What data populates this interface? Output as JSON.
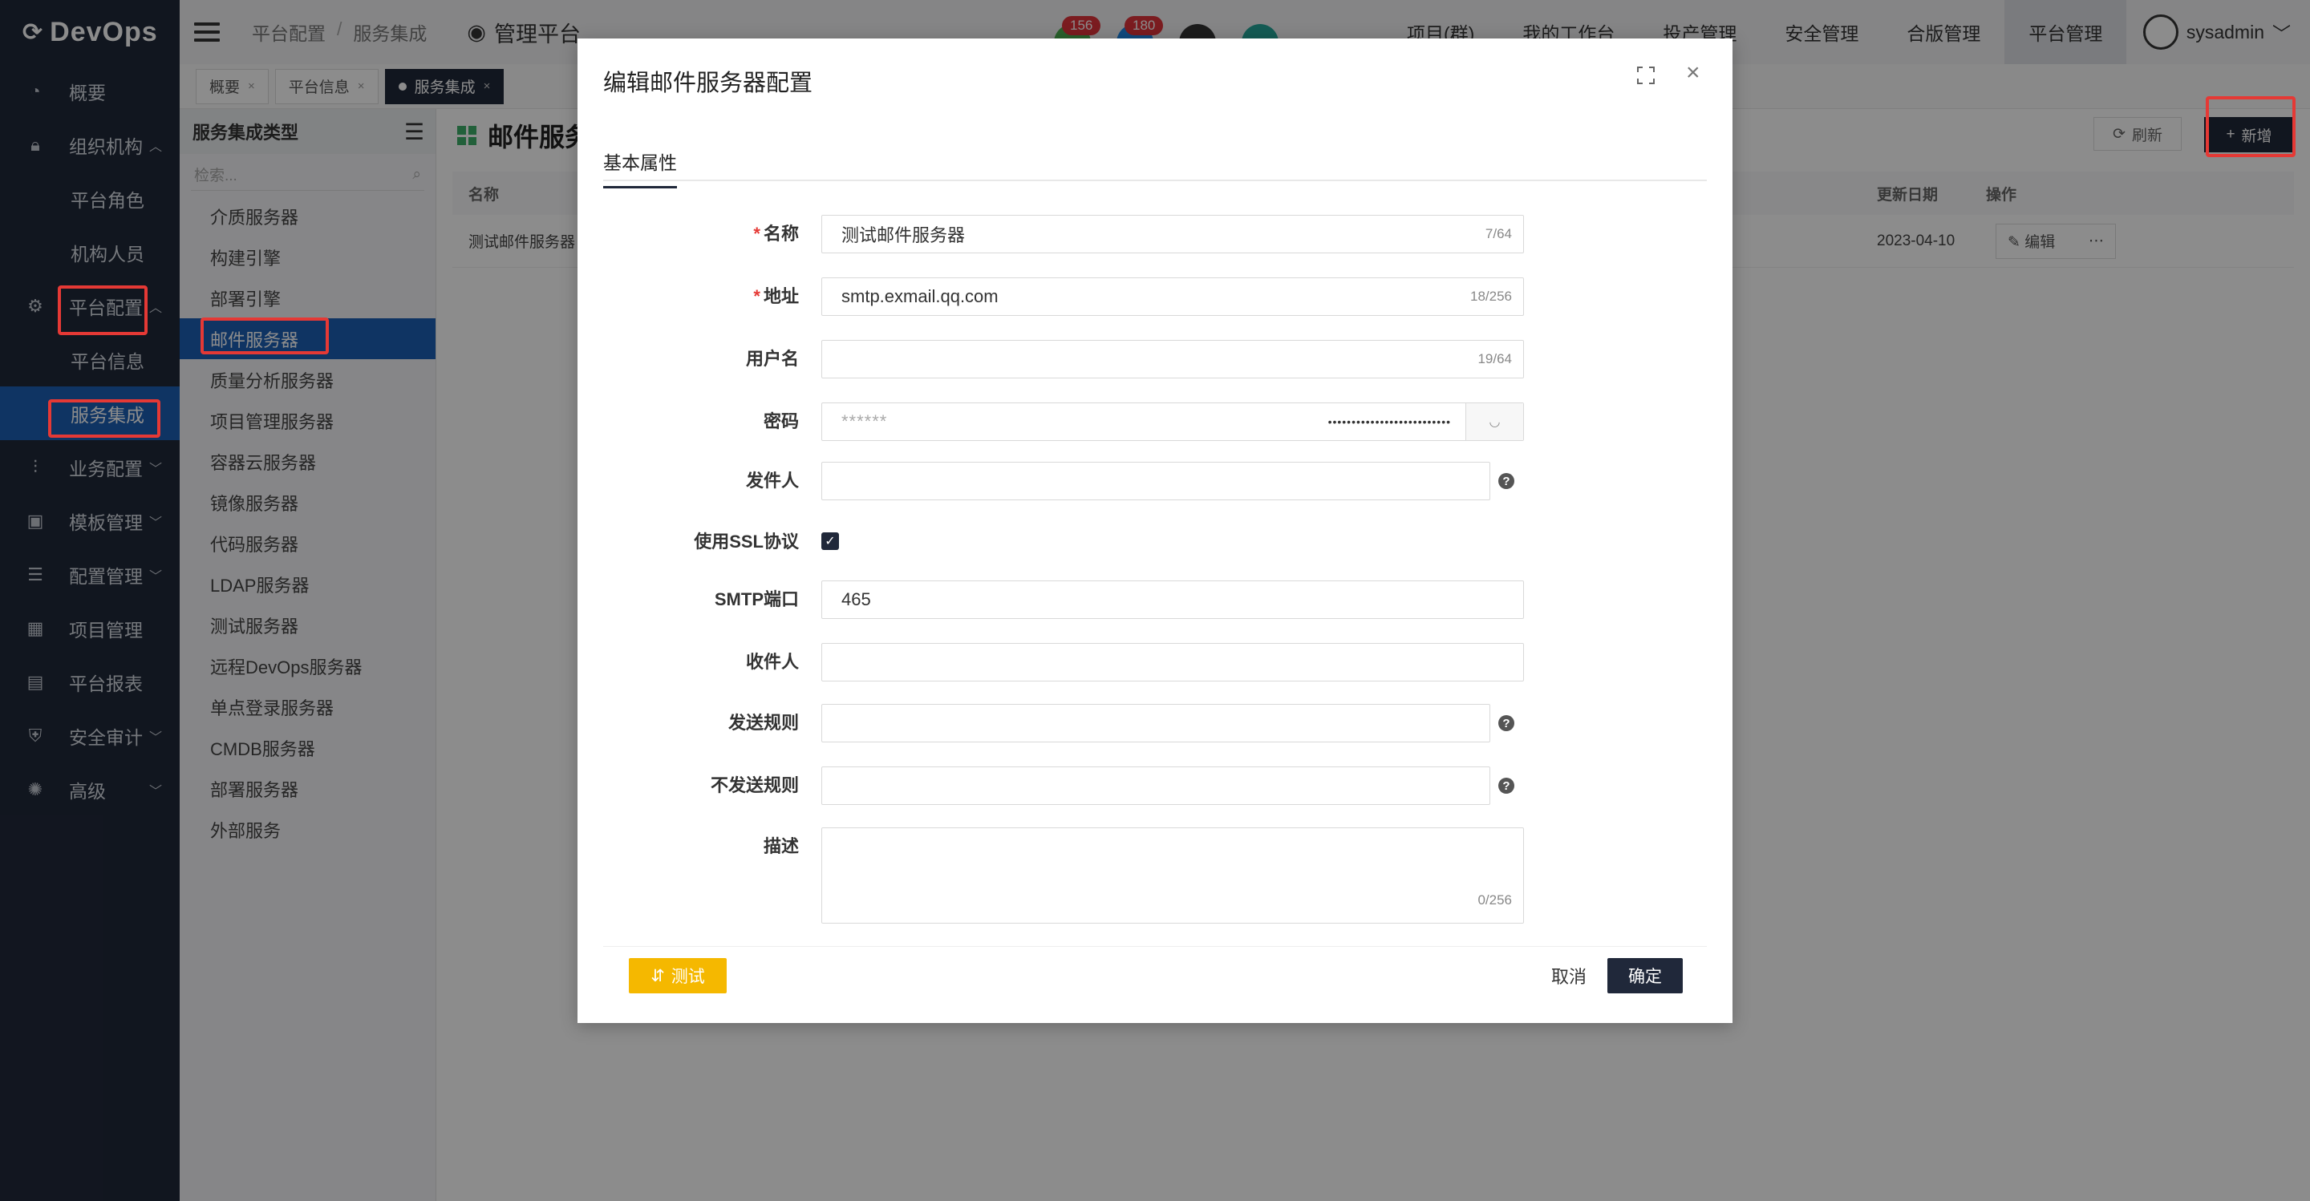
{
  "app": {
    "logo": "DevOps"
  },
  "sidebar": {
    "items": [
      {
        "label": "概要",
        "icon": "dashboard-icon"
      },
      {
        "label": "组织机构",
        "icon": "lock-icon"
      },
      {
        "label": "平台角色"
      },
      {
        "label": "机构人员"
      },
      {
        "label": "平台配置",
        "icon": "gear-icon"
      },
      {
        "label": "平台信息"
      },
      {
        "label": "服务集成"
      },
      {
        "label": "业务配置",
        "icon": "sliders-icon"
      },
      {
        "label": "模板管理",
        "icon": "template-icon"
      },
      {
        "label": "配置管理",
        "icon": "database-icon"
      },
      {
        "label": "项目管理",
        "icon": "grid-icon"
      },
      {
        "label": "平台报表",
        "icon": "report-icon"
      },
      {
        "label": "安全审计",
        "icon": "shield-icon"
      },
      {
        "label": "高级",
        "icon": "advanced-icon"
      }
    ]
  },
  "topbar": {
    "breadcrumb": [
      "平台配置",
      "服务集成"
    ],
    "platform_label": "管理平台",
    "badges": [
      {
        "count": "156",
        "color": "#4caf50",
        "icon": "doc-icon"
      },
      {
        "count": "180",
        "color": "#1e88e5",
        "icon": "bell-icon"
      },
      {
        "count": "",
        "color": "#333333",
        "icon": "help-icon"
      },
      {
        "count": "",
        "color": "#26a69a",
        "icon": "link-icon"
      }
    ],
    "nav": [
      "项目(群)",
      "我的工作台",
      "投产管理",
      "安全管理",
      "合版管理",
      "平台管理"
    ],
    "user": "sysadmin"
  },
  "page_tabs": [
    "概要",
    "平台信息",
    "服务集成"
  ],
  "type_panel": {
    "title": "服务集成类型",
    "search_placeholder": "检索...",
    "items": [
      "介质服务器",
      "构建引擎",
      "部署引擎",
      "邮件服务器",
      "质量分析服务器",
      "项目管理服务器",
      "容器云服务器",
      "镜像服务器",
      "代码服务器",
      "LDAP服务器",
      "测试服务器",
      "远程DevOps服务器",
      "单点登录服务器",
      "CMDB服务器",
      "部署服务器",
      "外部服务"
    ]
  },
  "main": {
    "title": "邮件服务",
    "refresh_label": "刷新",
    "add_label": "新增",
    "columns": {
      "name": "名称",
      "date": "更新日期",
      "op": "操作"
    },
    "rows": [
      {
        "name": "测试邮件服务器",
        "date": "2023-04-10",
        "edit": "编辑"
      }
    ]
  },
  "modal": {
    "title": "编辑邮件服务器配置",
    "tab": "基本属性",
    "fields": {
      "name": {
        "label": "名称",
        "value": "测试邮件服务器",
        "count": "7/64"
      },
      "address": {
        "label": "地址",
        "value": "smtp.exmail.qq.com",
        "count": "18/256"
      },
      "username": {
        "label": "用户名",
        "value": "",
        "count": "19/64"
      },
      "password": {
        "label": "密码",
        "placeholder": "******",
        "dots": "••••••••••••••••••••••••••"
      },
      "sender": {
        "label": "发件人",
        "value": ""
      },
      "ssl": {
        "label": "使用SSL协议",
        "checked": true
      },
      "port": {
        "label": "SMTP端口",
        "value": "465"
      },
      "recipient": {
        "label": "收件人",
        "value": ""
      },
      "send_rule": {
        "label": "发送规则",
        "value": ""
      },
      "no_send_rule": {
        "label": "不发送规则",
        "value": ""
      },
      "description": {
        "label": "描述",
        "value": "",
        "count": "0/256"
      }
    },
    "buttons": {
      "test": "测试",
      "cancel": "取消",
      "ok": "确定"
    }
  },
  "colors": {
    "nav_bg": "#20283a",
    "active_blue": "#1d5fb4",
    "highlight_red": "#e53935",
    "test_yellow": "#f5b800"
  }
}
